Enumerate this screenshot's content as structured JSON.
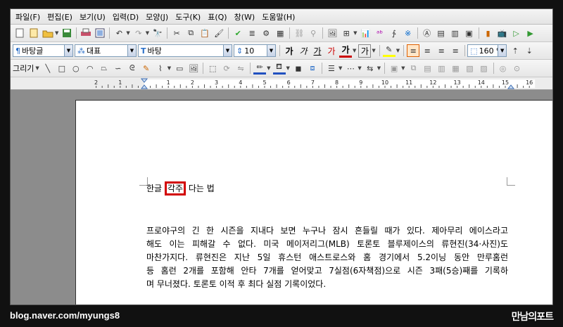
{
  "menu": [
    "파일(F)",
    "편집(E)",
    "보기(U)",
    "입력(D)",
    "모양(J)",
    "도구(K)",
    "표(Q)",
    "창(W)",
    "도움말(H)"
  ],
  "format_bar": {
    "style": "바탕글",
    "font_type": "대표",
    "font_name": "바탕",
    "font_size": "10",
    "bold": "가",
    "italic": "가",
    "underline": "가",
    "strike": "가",
    "font_color": "가",
    "char_effect": "가",
    "zoom": "160 %"
  },
  "draw_bar": {
    "label": "그리기"
  },
  "ruler": {
    "marks": [
      "2",
      "1",
      "1",
      "2",
      "3",
      "4",
      "5",
      "6",
      "7",
      "8",
      "9",
      "10",
      "11",
      "12",
      "13",
      "14",
      "15",
      "16"
    ]
  },
  "document": {
    "title_before": "한글",
    "title_highlight": "각주",
    "title_after": "다는 법",
    "lines": [
      "프로야구의 긴 한 시즌을 지내다 보면 누구나 잠시 흔들릴 때가 있다. 제아무리 에이스라고",
      "해도 이는 피해갈 수 없다. 미국 메이저리그(MLB) 토론토 블루제이스의 류현진(34·사진)도",
      "마찬가지다. 류현진은 지난 5일 휴스턴 애스트로스와 홈 경기에서 5.2이닝 동안 만루홈런",
      "등 홈런 2개를 포함해 안타 7개를 얻어맞고 7실점(6자책점)으로 시즌 3패(5승)째를 기록하",
      "며 무너졌다. 토론토 이적 후 최다 실점 기록이었다."
    ]
  },
  "watermark": {
    "left": "blog.naver.com/myungs8",
    "right": "만남의포트"
  },
  "colors": {
    "highlight": "#d20000",
    "squiggle": "#e06060"
  }
}
